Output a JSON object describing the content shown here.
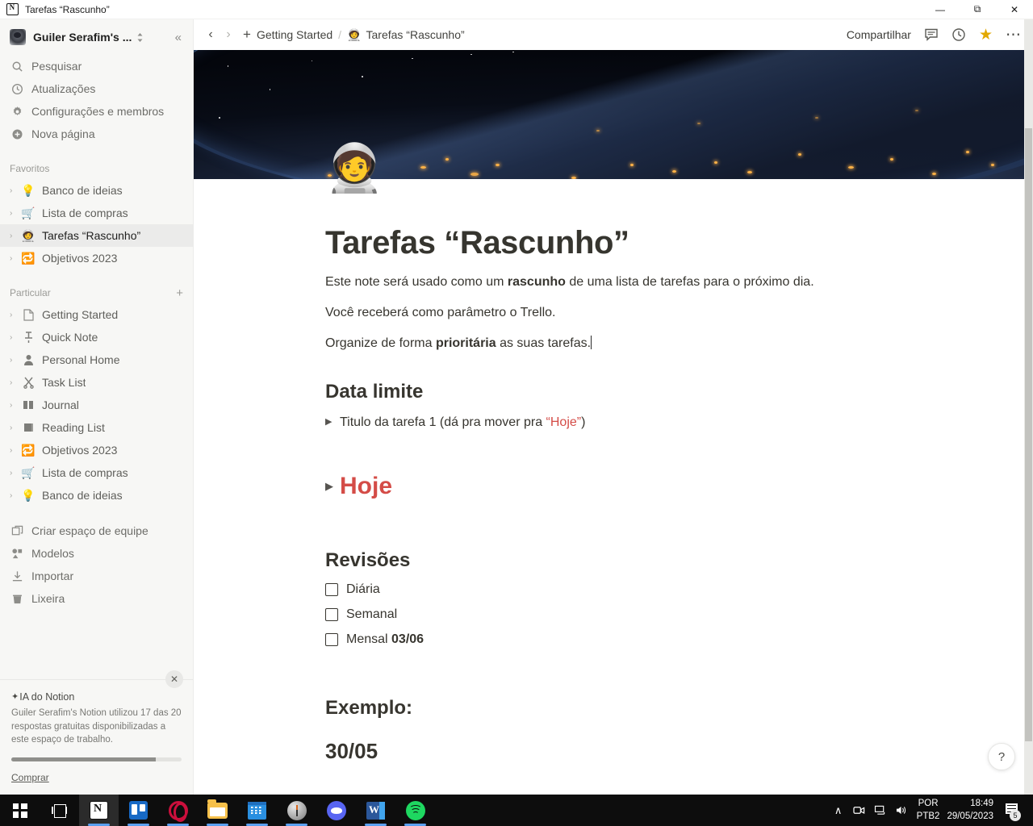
{
  "window": {
    "title": "Tarefas “Rascunho”",
    "minimize": "—",
    "maximize": "❐",
    "close": "✕"
  },
  "sidebar": {
    "workspace": {
      "name": "Guiler Serafim's ...",
      "chevron_icon": "chevron-updown-icon",
      "collapse_icon": "«"
    },
    "nav": [
      {
        "label": "Pesquisar",
        "icon": "search-icon"
      },
      {
        "label": "Atualizações",
        "icon": "clock-icon"
      },
      {
        "label": "Configurações e membros",
        "icon": "gear-icon"
      },
      {
        "label": "Nova página",
        "icon": "plus-circle-icon"
      }
    ],
    "favorites": {
      "title": "Favoritos",
      "items": [
        {
          "label": "Banco de ideias",
          "emoji": "💡",
          "selected": false
        },
        {
          "label": "Lista de compras",
          "emoji": "🛒",
          "selected": false
        },
        {
          "label": "Tarefas “Rascunho”",
          "emoji": "🧑‍🚀",
          "selected": true
        },
        {
          "label": "Objetivos 2023",
          "emoji": "🔁",
          "selected": false
        }
      ]
    },
    "private": {
      "title": "Particular",
      "add_icon": "plus-icon",
      "items": [
        {
          "label": "Getting Started",
          "emoji": "📄"
        },
        {
          "label": "Quick Note",
          "emoji": "📌"
        },
        {
          "label": "Personal Home",
          "emoji": "👤"
        },
        {
          "label": "Task List",
          "emoji": "✂️"
        },
        {
          "label": "Journal",
          "emoji": "📖"
        },
        {
          "label": "Reading List",
          "emoji": "📚"
        },
        {
          "label": "Objetivos 2023",
          "emoji": "🔁"
        },
        {
          "label": "Lista de compras",
          "emoji": "🛒"
        },
        {
          "label": "Banco de ideias",
          "emoji": "💡"
        }
      ]
    },
    "bottom": [
      {
        "label": "Criar espaço de equipe",
        "icon": "team-space-icon"
      },
      {
        "label": "Modelos",
        "icon": "templates-icon"
      },
      {
        "label": "Importar",
        "icon": "import-icon"
      },
      {
        "label": "Lixeira",
        "icon": "trash-icon"
      }
    ],
    "ai_panel": {
      "title": "IA do Notion",
      "spark_icon": "sparkle-icon",
      "body": "Guiler Serafim's Notion utilizou 17 das 20 respostas gratuitas disponibilizadas a este espaço de trabalho.",
      "used": 17,
      "total": 20,
      "progress_percent": 85,
      "cta": "Comprar",
      "close_icon": "✕"
    }
  },
  "topbar": {
    "back_icon": "chevron-left-icon",
    "forward_icon": "chevron-right-icon",
    "add_icon": "plus-icon",
    "breadcrumb": [
      {
        "label": "Getting Started",
        "emoji": ""
      },
      {
        "label": "Tarefas “Rascunho”",
        "emoji": "🧑‍🚀"
      }
    ],
    "separator": "/",
    "share_label": "Compartilhar",
    "comment_icon": "comment-icon",
    "history_icon": "clock-icon",
    "favorite_icon": "star-icon",
    "more_icon": "•••",
    "star_color": "#e2a800"
  },
  "page": {
    "emoji": "🧑‍🚀",
    "title": "Tarefas “Rascunho”",
    "paragraphs": [
      {
        "pre": "Este note será usado como um ",
        "bold": "rascunho",
        "post": " de uma lista de tarefas para o próximo dia."
      },
      {
        "pre": "Você receberá como parâmetro o Trello.",
        "bold": "",
        "post": ""
      },
      {
        "pre": "Organize de forma ",
        "bold": "prioritária",
        "post": " as suas tarefas."
      }
    ],
    "sections": {
      "data_limite": {
        "heading": "Data limite",
        "toggle_arrow": "▶",
        "item_pre": "Titulo da tarefa 1 (dá pra mover pra ",
        "item_red": "“Hoje”",
        "item_post": ")"
      },
      "hoje": {
        "label": "Hoje",
        "toggle_arrow": "▶",
        "color": "#d44c47"
      },
      "revisoes": {
        "heading": "Revisões",
        "todos": [
          {
            "label": "Diária",
            "bold": "",
            "checked": false
          },
          {
            "label": "Semanal",
            "bold": "",
            "checked": false
          },
          {
            "label": "Mensal ",
            "bold": "03/06",
            "checked": false
          }
        ]
      },
      "exemplo": {
        "heading": "Exemplo:",
        "date": "30/05"
      }
    },
    "help_icon": "?"
  },
  "taskbar": {
    "items": [
      {
        "name": "start-button",
        "icon": "windows-logo-icon"
      },
      {
        "name": "task-view-button",
        "icon": "task-view-icon"
      },
      {
        "name": "notion-app",
        "icon": "notion-icon",
        "active": true,
        "running": true
      },
      {
        "name": "trello-app",
        "icon": "trello-icon",
        "running": true
      },
      {
        "name": "opera-app",
        "icon": "opera-icon",
        "running": true
      },
      {
        "name": "file-explorer-app",
        "icon": "folder-icon",
        "running": true
      },
      {
        "name": "calendar-app",
        "icon": "calendar-icon",
        "running": true
      },
      {
        "name": "clock-app",
        "icon": "clock-icon",
        "running": true
      },
      {
        "name": "discord-app",
        "icon": "discord-icon",
        "running": false
      },
      {
        "name": "word-app",
        "icon": "word-icon",
        "running": true
      },
      {
        "name": "spotify-app",
        "icon": "spotify-icon",
        "running": true
      }
    ],
    "tray": {
      "expand_icon": "∧",
      "camera_icon": "camera-icon",
      "network_icon": "network-icon",
      "volume_icon": "volume-icon",
      "lang_line1": "POR",
      "lang_line2": "PTB2",
      "time": "18:49",
      "date": "29/05/2023",
      "notifications_count": "5"
    }
  }
}
